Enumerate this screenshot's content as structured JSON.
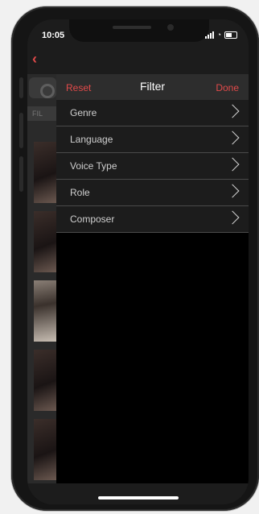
{
  "status_bar": {
    "time": "10:05",
    "wifi_icon": "wifi-icon",
    "battery_icon": "battery-icon"
  },
  "nav": {
    "back_icon": "chevron-left-icon",
    "accent_color": "#e14a4a"
  },
  "background_list": {
    "filter_label": "FIL"
  },
  "filter_sheet": {
    "reset_label": "Reset",
    "title": "Filter",
    "done_label": "Done",
    "rows": [
      {
        "label": "Genre"
      },
      {
        "label": "Language"
      },
      {
        "label": "Voice Type"
      },
      {
        "label": "Role"
      },
      {
        "label": "Composer"
      }
    ]
  }
}
